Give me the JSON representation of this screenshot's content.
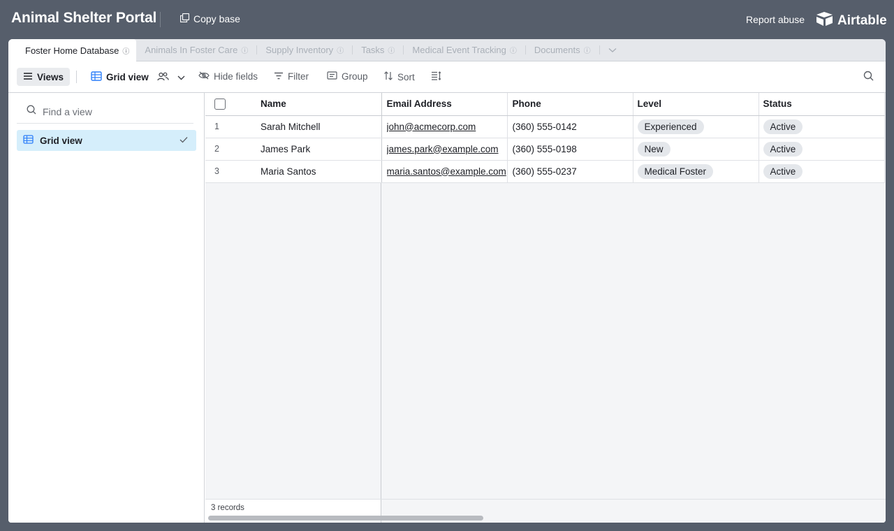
{
  "header": {
    "base_title": "Animal Shelter Portal",
    "copy_base_label": "Copy base",
    "report_abuse_label": "Report abuse",
    "brand_name": "Airtable"
  },
  "tabs": [
    {
      "label": "Foster Home Database",
      "active": true
    },
    {
      "label": "Animals In Foster Care",
      "active": false
    },
    {
      "label": "Supply Inventory",
      "active": false
    },
    {
      "label": "Tasks",
      "active": false
    },
    {
      "label": "Medical Event Tracking",
      "active": false
    },
    {
      "label": "Documents",
      "active": false
    }
  ],
  "toolbar": {
    "views_label": "Views",
    "current_view": "Grid view",
    "hide_fields_label": "Hide fields",
    "filter_label": "Filter",
    "group_label": "Group",
    "sort_label": "Sort"
  },
  "sidebar": {
    "find_placeholder": "Find a view",
    "views": [
      {
        "label": "Grid view",
        "selected": true
      }
    ]
  },
  "grid": {
    "columns": [
      "Name",
      "Email Address",
      "Phone",
      "Level",
      "Status"
    ],
    "rows": [
      {
        "num": "1",
        "name": "Sarah Mitchell",
        "email": "john@acmecorp.com",
        "phone": "(360) 555-0142",
        "level": "Experienced",
        "status": "Active"
      },
      {
        "num": "2",
        "name": "James Park",
        "email": "james.park@example.com",
        "phone": "(360) 555-0198",
        "level": "New",
        "status": "Active"
      },
      {
        "num": "3",
        "name": "Maria Santos",
        "email": "maria.santos@example.com",
        "phone": "(360) 555-0237",
        "level": "Medical Foster",
        "status": "Active"
      }
    ],
    "record_count": "3 records"
  },
  "colors": {
    "page_bg": "#565e6b",
    "selected_view_bg": "#d5eefb",
    "grid_view_icon": "#2d7ff9",
    "pill_bg": "#e4e7eb"
  },
  "icons": [
    "copy-icon",
    "airtable-logo-icon",
    "info-icon",
    "chevron-down-icon",
    "menu-icon",
    "grid-icon",
    "collaborators-icon",
    "eye-slash-icon",
    "filter-icon",
    "group-icon",
    "sort-icon",
    "row-height-icon",
    "search-icon",
    "check-icon"
  ]
}
